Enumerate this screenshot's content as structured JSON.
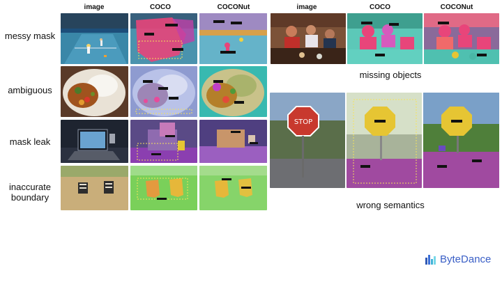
{
  "columns_left": [
    "image",
    "COCO",
    "COCONut"
  ],
  "columns_right": [
    "image",
    "COCO",
    "COCONut"
  ],
  "rows": [
    "messy mask",
    "ambiguous",
    "mask leak",
    "inaccurate\nboundary"
  ],
  "captions": {
    "missing": "missing objects",
    "wrong": "wrong semantics"
  },
  "panel_labels": {
    "tennis_coco": [
      "person",
      "person",
      "sports ball",
      "tennis racket"
    ],
    "tennis_coconut": [
      "playingfield",
      "person",
      "person"
    ],
    "signs": [
      "STOP"
    ],
    "sign_labels_coco": [
      "stop sign",
      "road",
      "tree"
    ],
    "sign_labels_coconut": [
      "stop sign",
      "road",
      "tree",
      "sky"
    ]
  },
  "brand": {
    "name": "ByteDance"
  },
  "colors": {
    "pink": "#e8457a",
    "purple": "#9b5fc0",
    "yellow": "#e6c533",
    "teal": "#49b7a6",
    "green": "#7ad05a",
    "magenta": "#c040a8"
  }
}
